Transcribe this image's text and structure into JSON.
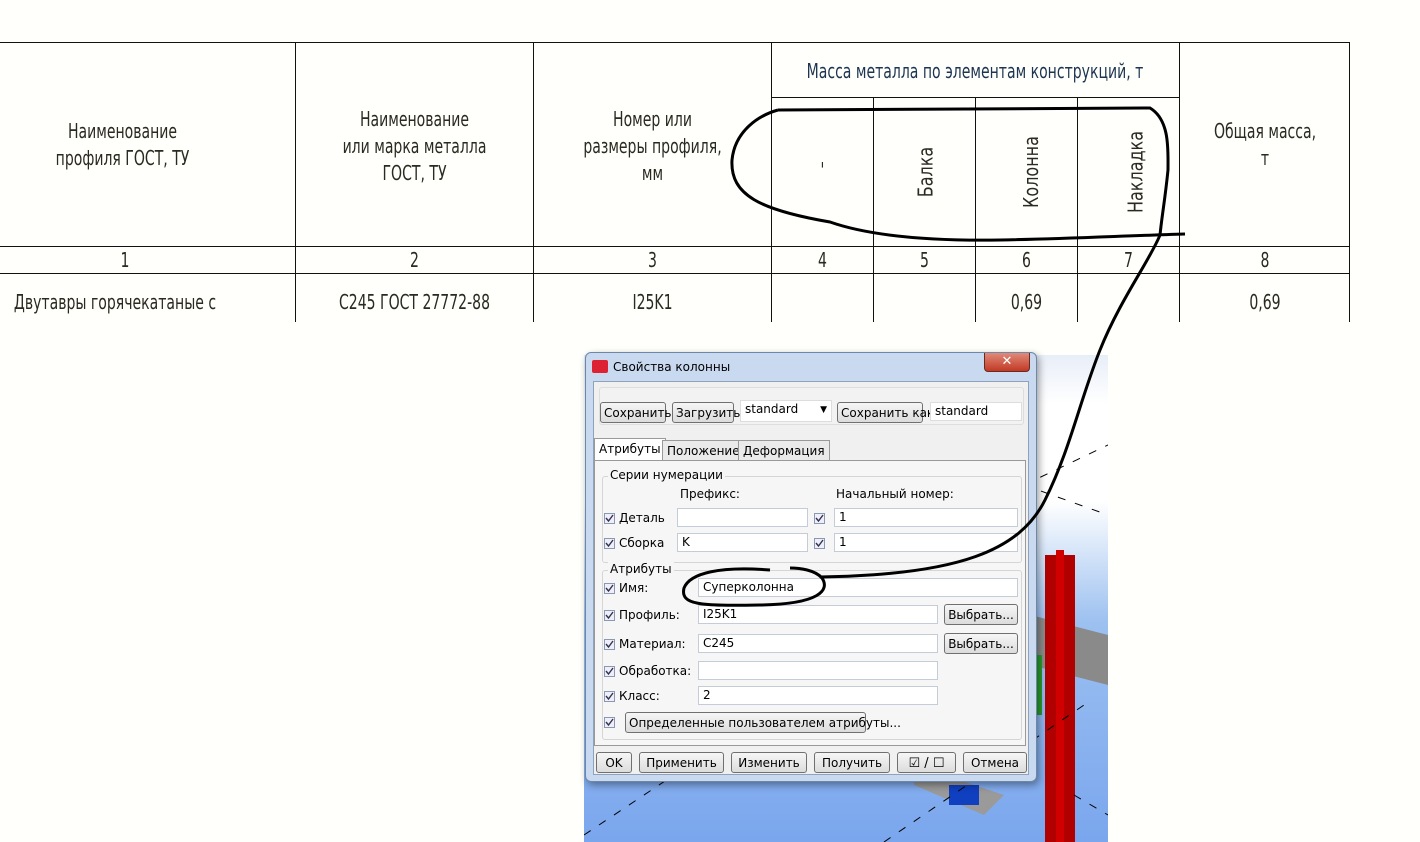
{
  "table": {
    "headers": {
      "col1": [
        "Наименование",
        "профиля ГОСТ, ТУ"
      ],
      "col2": [
        "Наименование",
        "или марка металла",
        "ГОСТ, ТУ"
      ],
      "col3": [
        "Номер или",
        "размеры профиля,",
        "мм"
      ],
      "mass_group": "Масса металла по элементам конструкций, т",
      "col4": "'",
      "col5": "Балка",
      "col6": "Колонна",
      "col7": "Накладка",
      "col8": [
        "Общая масса,",
        "т"
      ]
    },
    "column_numbers": [
      "1",
      "2",
      "3",
      "4",
      "5",
      "6",
      "7",
      "8"
    ],
    "rows": [
      {
        "name": "Двутавры горячекатаные с",
        "material": "С245 ГОСТ 27772-88",
        "profile": "I25K1",
        "c4": "",
        "c5": "",
        "c6": "0,69",
        "c7": "",
        "total": "0,69"
      }
    ]
  },
  "dialog": {
    "title": "Свойства колонны",
    "toolbar": {
      "save": "Сохранить",
      "load": "Загрузить",
      "preset": "standard",
      "save_as": "Сохранить как",
      "save_as_name": "standard"
    },
    "tabs": [
      "Атрибуты",
      "Положение",
      "Деформация"
    ],
    "numbering": {
      "group_label": "Серии нумерации",
      "prefix_header": "Префикс:",
      "start_header": "Начальный номер:",
      "part_label": "Деталь",
      "part_prefix": "",
      "part_start": "1",
      "assembly_label": "Сборка",
      "assembly_prefix": "K",
      "assembly_start": "1"
    },
    "attributes": {
      "group_label": "Атрибуты",
      "name_label": "Имя:",
      "name_value": "Суперколонна",
      "profile_label": "Профиль:",
      "profile_value": "I25K1",
      "material_label": "Материал:",
      "material_value": "C245",
      "finish_label": "Обработка:",
      "finish_value": "",
      "class_label": "Класс:",
      "class_value": "2",
      "select_label": "Выбрать...",
      "udа_label": "Определенные пользователем атрибуты..."
    },
    "footer": {
      "ok": "OK",
      "apply": "Применить",
      "modify": "Изменить",
      "get": "Получить",
      "cancel": "Отмена"
    },
    "colors": {
      "accent": "#c9daf0",
      "close": "#c74a3a"
    }
  }
}
